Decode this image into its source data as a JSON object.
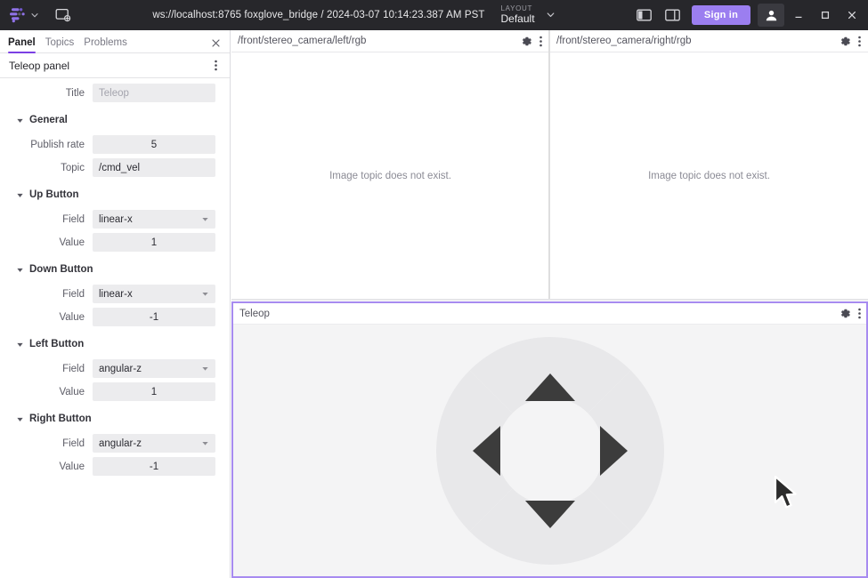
{
  "titlebar": {
    "logo_icon": "foxglove-logo-icon",
    "logo_chevron_icon": "chevron-down-icon",
    "add_panel_icon": "add-panel-icon",
    "data_source": "ws://localhost:8765 foxglove_bridge / 2024-03-07 10:14:23.387 AM PST",
    "layout_label": "LAYOUT",
    "layout_value": "Default",
    "layout_chevron_icon": "chevron-down-icon",
    "left_sidebar_icon": "left-sidebar-toggle-icon",
    "right_sidebar_icon": "right-sidebar-toggle-icon",
    "signin_label": "Sign in",
    "account_icon": "account-icon",
    "minimize_icon": "minimize-icon",
    "maximize_icon": "maximize-icon",
    "close_icon": "close-icon",
    "accent_color": "#9b7ef0",
    "background_color": "#27272b"
  },
  "sidebar": {
    "tabs": [
      {
        "label": "Panel",
        "active": true
      },
      {
        "label": "Topics",
        "active": false
      },
      {
        "label": "Problems",
        "active": false
      }
    ],
    "close_icon": "close-icon",
    "panel_title": "Teleop panel",
    "panel_menu_icon": "kebab-menu-icon",
    "accent_color": "#7b3fe4",
    "title_row": {
      "label": "Title",
      "placeholder": "Teleop",
      "value": ""
    },
    "groups": [
      {
        "name": "General",
        "expanded": true,
        "rows": [
          {
            "label": "Publish rate",
            "value": "5",
            "type": "number"
          },
          {
            "label": "Topic",
            "value": "/cmd_vel",
            "type": "text"
          }
        ]
      },
      {
        "name": "Up Button",
        "expanded": true,
        "rows": [
          {
            "label": "Field",
            "value": "linear-x",
            "type": "select"
          },
          {
            "label": "Value",
            "value": "1",
            "type": "number"
          }
        ]
      },
      {
        "name": "Down Button",
        "expanded": true,
        "rows": [
          {
            "label": "Field",
            "value": "linear-x",
            "type": "select"
          },
          {
            "label": "Value",
            "value": "-1",
            "type": "number"
          }
        ]
      },
      {
        "name": "Left Button",
        "expanded": true,
        "rows": [
          {
            "label": "Field",
            "value": "angular-z",
            "type": "select"
          },
          {
            "label": "Value",
            "value": "1",
            "type": "number"
          }
        ]
      },
      {
        "name": "Right Button",
        "expanded": true,
        "rows": [
          {
            "label": "Field",
            "value": "angular-z",
            "type": "select"
          },
          {
            "label": "Value",
            "value": "-1",
            "type": "number"
          }
        ]
      }
    ]
  },
  "panels": {
    "camera_left": {
      "title": "/front/stereo_camera/left/rgb",
      "message": "Image topic does not exist.",
      "settings_icon": "gear-icon",
      "menu_icon": "kebab-menu-icon"
    },
    "camera_right": {
      "title": "/front/stereo_camera/right/rgb",
      "message": "Image topic does not exist.",
      "settings_icon": "gear-icon",
      "menu_icon": "kebab-menu-icon"
    },
    "teleop": {
      "title": "Teleop",
      "settings_icon": "gear-icon",
      "menu_icon": "kebab-menu-icon",
      "selected_border_color": "#a78bf0",
      "dpad": {
        "up_icon": "arrow-up-icon",
        "down_icon": "arrow-down-icon",
        "left_icon": "arrow-left-icon",
        "right_icon": "arrow-right-icon",
        "segment_color": "#e8e8ea",
        "arrow_color": "#3c3c3c"
      }
    }
  },
  "cursor": {
    "icon": "mouse-pointer-icon"
  }
}
